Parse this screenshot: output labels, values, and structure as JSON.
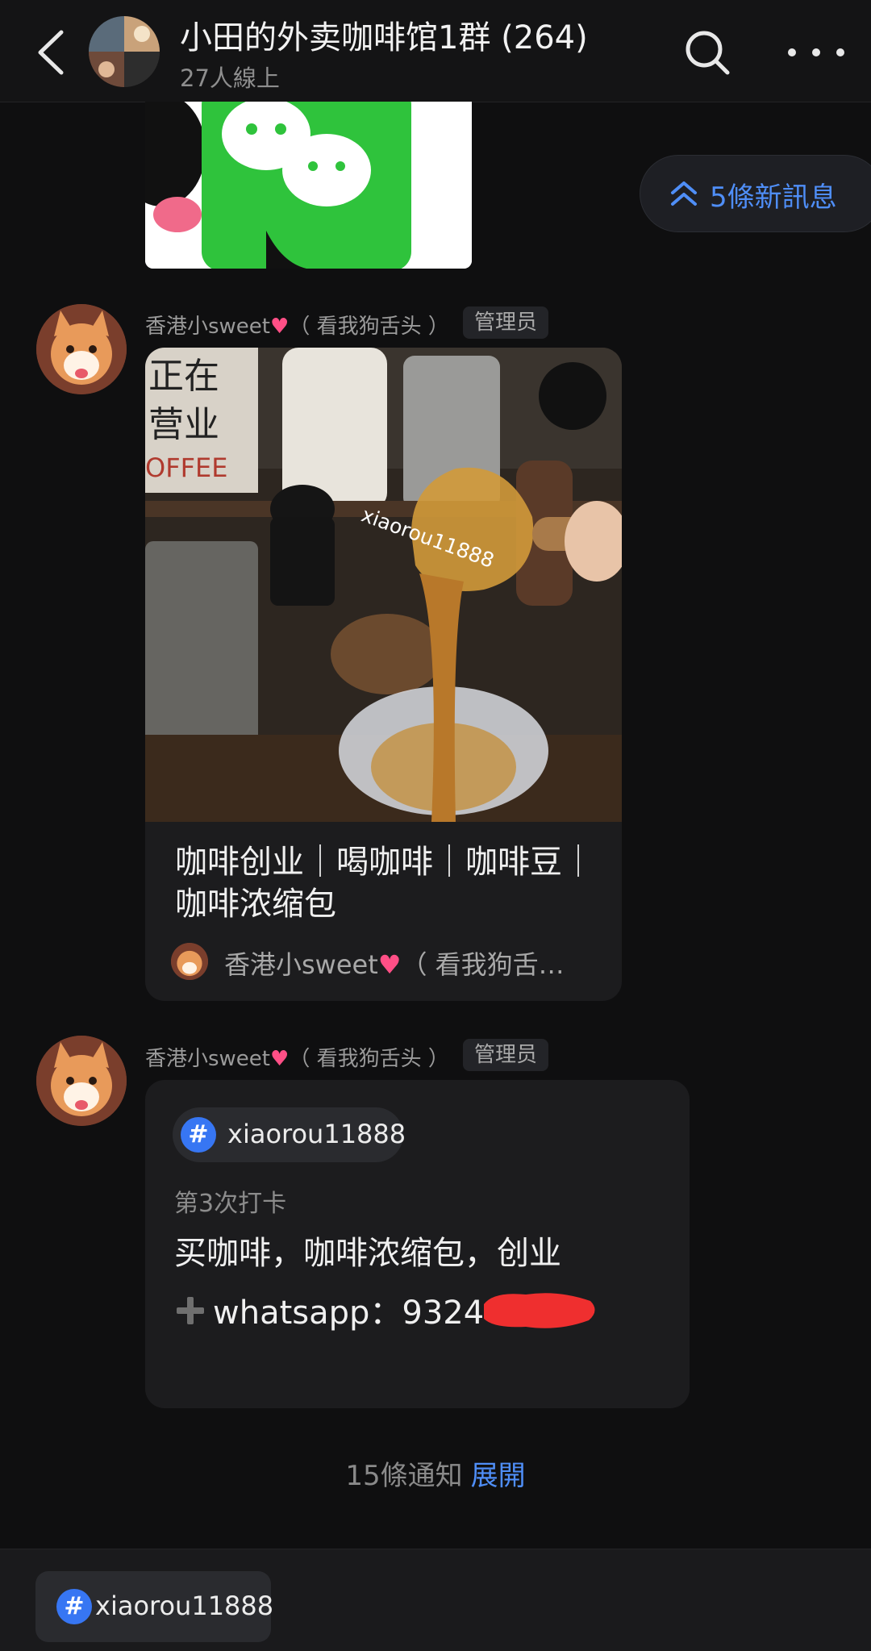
{
  "header": {
    "title": "小田的外卖咖啡馆1群 (264)",
    "subtitle": "27人線上",
    "back_icon": "chevron-left-icon",
    "search_icon": "search-icon",
    "more_icon": "more-dots-icon"
  },
  "new_messages": {
    "label": "5條新訊息",
    "icon": "double-chevron-up-icon"
  },
  "messages": [
    {
      "sender": "香港小sweet",
      "sender_suffix": "（ 看我狗舌头 ）",
      "badge": "管理员",
      "card_title": "咖啡创业｜喝咖啡｜咖啡豆｜咖啡浓缩包",
      "card_author": "香港小sweet",
      "card_author_suffix": "（ 看我狗舌…",
      "watermark": "xiaorou11888"
    },
    {
      "sender": "香港小sweet",
      "sender_suffix": "（ 看我狗舌头 ）",
      "badge": "管理员",
      "tag": "xiaorou11888",
      "meta": "第3次打卡",
      "line1": "买咖啡，咖啡浓缩包，创业",
      "line2": "whatsapp：9324"
    }
  ],
  "notice": {
    "text": "15條通知",
    "action": "展開"
  },
  "bottom_tag": "xiaorou11888",
  "colors": {
    "accent": "#4f8ef7",
    "background": "#0f0f10",
    "card": "#1c1c1e",
    "hash_badge": "#3776f3",
    "heart": "#ff4f86"
  }
}
